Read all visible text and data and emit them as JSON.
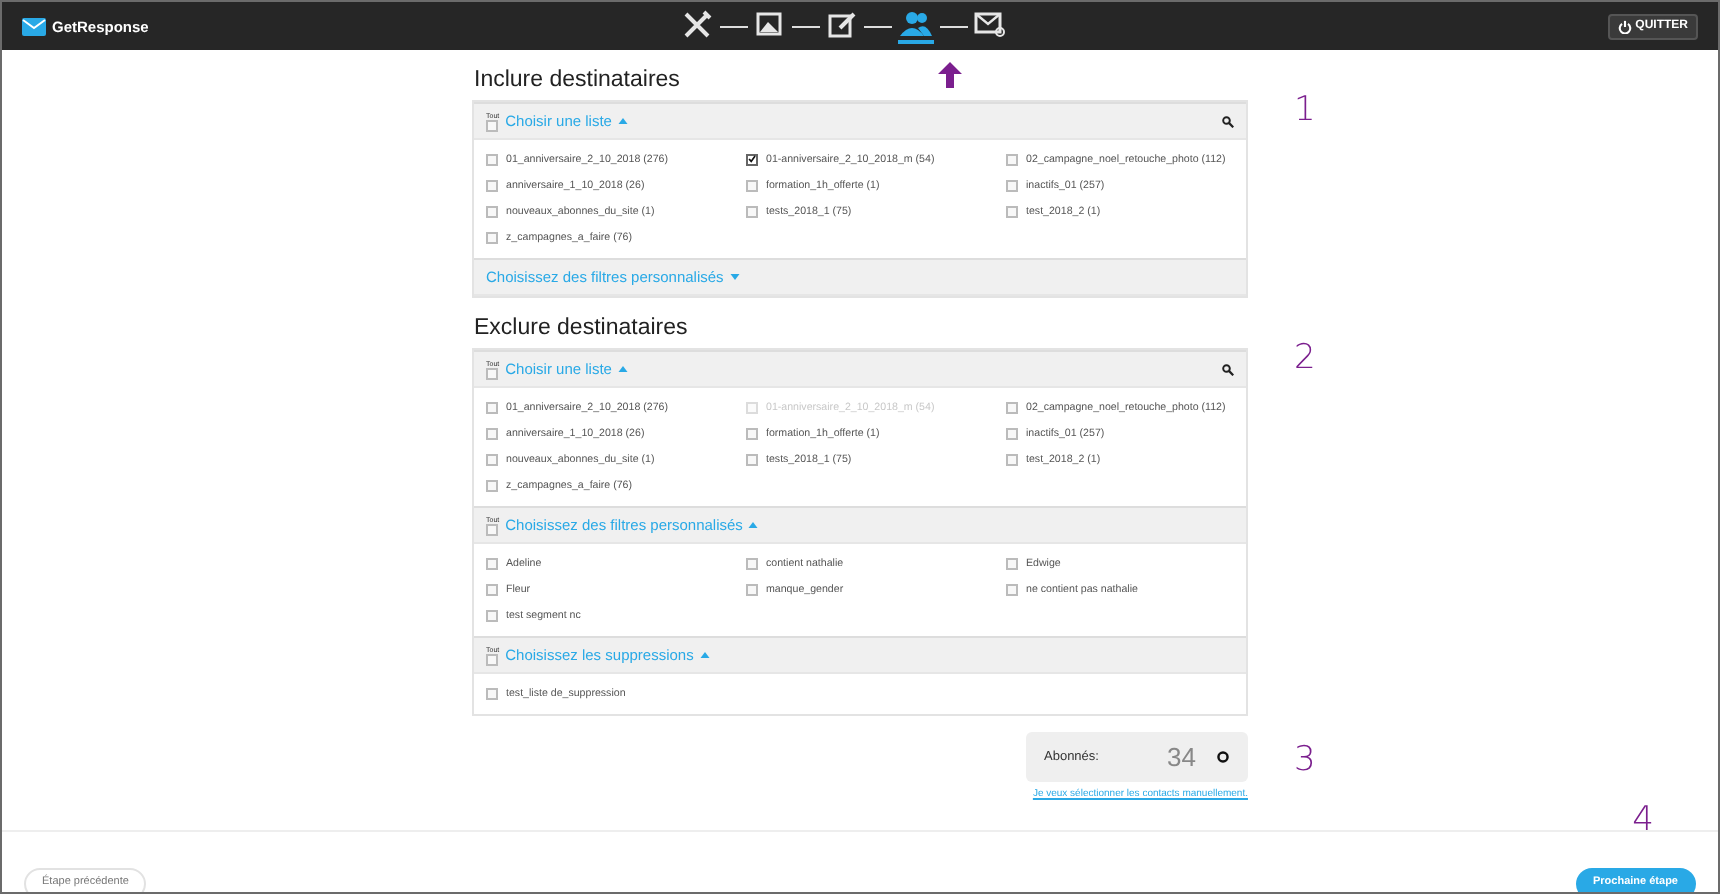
{
  "header": {
    "logo": "GetResponse",
    "steps": [
      {
        "kind": "tools",
        "selected": false
      },
      {
        "kind": "picture",
        "selected": false
      },
      {
        "kind": "edit",
        "selected": false
      },
      {
        "kind": "people",
        "selected": true
      },
      {
        "kind": "mail",
        "selected": false
      }
    ],
    "quit": "QUITTER"
  },
  "sections": [
    {
      "title": "Inclure destinataires",
      "annotation": "1",
      "groups": [
        {
          "all_label": "Tout",
          "all_checked": false,
          "heading": "Choisir une liste",
          "expanded": true,
          "searchable": true,
          "items": [
            {
              "label": "01_anniversaire_2_10_2018 (276)",
              "checked": false,
              "disabled": false
            },
            {
              "label": "01-anniversaire_2_10_2018_m (54)",
              "checked": true,
              "disabled": false
            },
            {
              "label": "02_campagne_noel_retouche_photo (112)",
              "checked": false,
              "disabled": false
            },
            {
              "label": "anniversaire_1_10_2018 (26)",
              "checked": false,
              "disabled": false
            },
            {
              "label": "formation_1h_offerte (1)",
              "checked": false,
              "disabled": false
            },
            {
              "label": "inactifs_01 (257)",
              "checked": false,
              "disabled": false
            },
            {
              "label": "nouveaux_abonnes_du_site (1)",
              "checked": false,
              "disabled": false
            },
            {
              "label": "tests_2018_1 (75)",
              "checked": false,
              "disabled": false
            },
            {
              "label": "test_2018_2 (1)",
              "checked": false,
              "disabled": false
            },
            {
              "label": "z_campagnes_a_faire (76)",
              "checked": false,
              "disabled": false
            }
          ]
        },
        {
          "heading": "Choisissez des filtres personnalisés",
          "expanded": false,
          "searchable": false
        }
      ]
    },
    {
      "title": "Exclure destinataires",
      "annotation": "2",
      "groups": [
        {
          "all_label": "Tout",
          "all_checked": false,
          "heading": "Choisir une liste",
          "expanded": true,
          "searchable": true,
          "items": [
            {
              "label": "01_anniversaire_2_10_2018 (276)",
              "checked": false,
              "disabled": false
            },
            {
              "label": "01-anniversaire_2_10_2018_m (54)",
              "checked": false,
              "disabled": true
            },
            {
              "label": "02_campagne_noel_retouche_photo (112)",
              "checked": false,
              "disabled": false
            },
            {
              "label": "anniversaire_1_10_2018 (26)",
              "checked": false,
              "disabled": false
            },
            {
              "label": "formation_1h_offerte (1)",
              "checked": false,
              "disabled": false
            },
            {
              "label": "inactifs_01 (257)",
              "checked": false,
              "disabled": false
            },
            {
              "label": "nouveaux_abonnes_du_site (1)",
              "checked": false,
              "disabled": false
            },
            {
              "label": "tests_2018_1 (75)",
              "checked": false,
              "disabled": false
            },
            {
              "label": "test_2018_2 (1)",
              "checked": false,
              "disabled": false
            },
            {
              "label": "z_campagnes_a_faire (76)",
              "checked": false,
              "disabled": false
            }
          ]
        },
        {
          "all_label": "Tout",
          "all_checked": false,
          "heading": "Choisissez des filtres personnalisés",
          "expanded": true,
          "searchable": false,
          "items": [
            {
              "label": "Adeline",
              "checked": false,
              "disabled": false
            },
            {
              "label": "contient nathalie",
              "checked": false,
              "disabled": false
            },
            {
              "label": "Edwige",
              "checked": false,
              "disabled": false
            },
            {
              "label": "Fleur",
              "checked": false,
              "disabled": false
            },
            {
              "label": "manque_gender",
              "checked": false,
              "disabled": false
            },
            {
              "label": "ne contient pas nathalie",
              "checked": false,
              "disabled": false
            },
            {
              "label": "test segment nc",
              "checked": false,
              "disabled": false
            }
          ]
        },
        {
          "all_label": "Tout",
          "all_checked": false,
          "heading": "Choisissez les suppressions",
          "expanded": true,
          "searchable": false,
          "items": [
            {
              "label": "test_liste de_suppression",
              "checked": false,
              "disabled": false
            }
          ]
        }
      ]
    }
  ],
  "subscribers": {
    "label": "Abonnés:",
    "count": "34",
    "annotation": "3"
  },
  "manual_link": "Je veux sélectionner les contacts manuellement.",
  "footer": {
    "previous": "Étape précédente",
    "next": "Prochaine étape",
    "annotation": "4"
  }
}
